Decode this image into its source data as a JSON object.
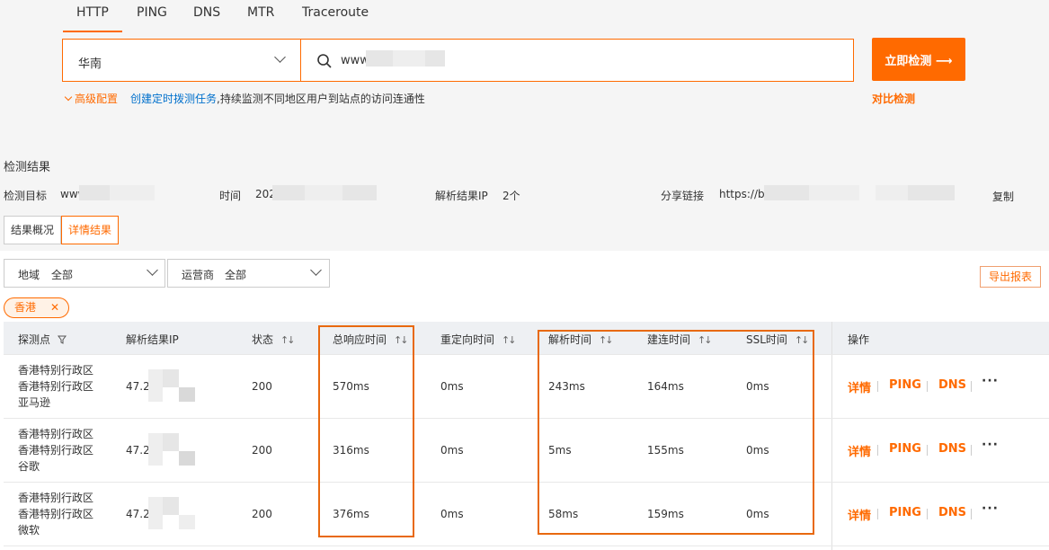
{
  "tabs": [
    {
      "label": "HTTP",
      "active": true
    },
    {
      "label": "PING",
      "active": false
    },
    {
      "label": "DNS",
      "active": false
    },
    {
      "label": "MTR",
      "active": false
    },
    {
      "label": "Traceroute",
      "active": false
    }
  ],
  "search": {
    "region": "华南",
    "url_value": "www",
    "submit_label": "立即检测 ⟶"
  },
  "options": {
    "advanced_label": "高级配置",
    "schedule_link": "创建定时拨测任务",
    "schedule_desc": ",持续监测不同地区用户到站点的访问连通性",
    "compare_label": "对比检测"
  },
  "result": {
    "section_title": "检测结果",
    "target_label": "检测目标",
    "target_value": "www",
    "time_label": "时间",
    "time_value": "202",
    "ip_label": "解析结果IP",
    "ip_count": "2个",
    "share_label": "分享链接",
    "share_value": "https://b",
    "copy_label": "复制"
  },
  "view_tabs": [
    {
      "label": "结果概况",
      "active": false
    },
    {
      "label": "详情结果",
      "active": true
    }
  ],
  "filters": {
    "region_label": "地域",
    "region_value": "全部",
    "isp_label": "运营商",
    "isp_value": "全部",
    "export_label": "导出报表",
    "chip_label": "香港",
    "chip_close": "✕"
  },
  "table": {
    "columns": [
      "探测点",
      "解析结果IP",
      "状态",
      "总响应时间",
      "重定向时间",
      "解析时间",
      "建连时间",
      "SSL时间",
      "操作"
    ],
    "rows": [
      {
        "location": [
          "香港特别行政区",
          "香港特别行政区",
          "亚马逊"
        ],
        "ip": "47.2",
        "status": "200",
        "total": "570ms",
        "redirect": "0ms",
        "dns": "243ms",
        "connect": "164ms",
        "ssl": "0ms"
      },
      {
        "location": [
          "香港特别行政区",
          "香港特别行政区",
          "谷歌"
        ],
        "ip": "47.2",
        "status": "200",
        "total": "316ms",
        "redirect": "0ms",
        "dns": "5ms",
        "connect": "155ms",
        "ssl": "0ms"
      },
      {
        "location": [
          "香港特别行政区",
          "香港特别行政区",
          "微软"
        ],
        "ip": "47.2",
        "status": "200",
        "total": "376ms",
        "redirect": "0ms",
        "dns": "58ms",
        "connect": "159ms",
        "ssl": "0ms"
      }
    ],
    "actions": [
      "详情",
      "PING",
      "DNS",
      "···"
    ]
  },
  "colors": {
    "accent": "#ff6a00",
    "link": "#0070cc",
    "highlight_box": "#e8690f"
  }
}
